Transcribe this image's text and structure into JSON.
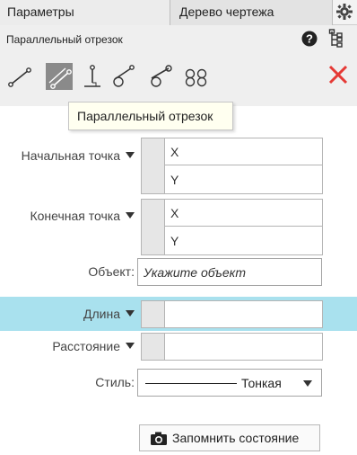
{
  "tabs": {
    "params_label": "Параметры",
    "tree_label": "Дерево чертежа",
    "settings_icon": "gear-icon"
  },
  "header": {
    "command_title": "Параллельный отрезок",
    "help_icon": "help-icon",
    "tree_icon": "tree-icon"
  },
  "toolbar": {
    "tools": [
      {
        "icon": "segment-by-two-points-icon",
        "active": false
      },
      {
        "icon": "parallel-segment-icon",
        "active": true
      },
      {
        "icon": "perpendicular-segment-icon",
        "active": false
      },
      {
        "icon": "tangent-segment-icon",
        "active": false
      },
      {
        "icon": "tangent-segment-two-curves-icon",
        "active": false
      },
      {
        "icon": "segment-between-circles-icon",
        "active": false
      }
    ],
    "close_icon": "close-icon",
    "close_color": "#e53935"
  },
  "tooltip": {
    "text": "Параллельный отрезок"
  },
  "form": {
    "start_point": {
      "label": "Начальная точка",
      "x_label": "X",
      "y_label": "Y",
      "x_value": "",
      "y_value": ""
    },
    "end_point": {
      "label": "Конечная точка",
      "x_label": "X",
      "y_label": "Y",
      "x_value": "",
      "y_value": ""
    },
    "object": {
      "label": "Объект:",
      "placeholder": "Укажите объект"
    },
    "length": {
      "label": "Длина",
      "value": "",
      "highlight_color": "#a9e1ee"
    },
    "distance": {
      "label": "Расстояние",
      "value": ""
    },
    "style": {
      "label": "Стиль:",
      "value": "Тонкая"
    }
  },
  "save_state": {
    "label": "Запомнить состояние",
    "icon": "camera-icon"
  }
}
